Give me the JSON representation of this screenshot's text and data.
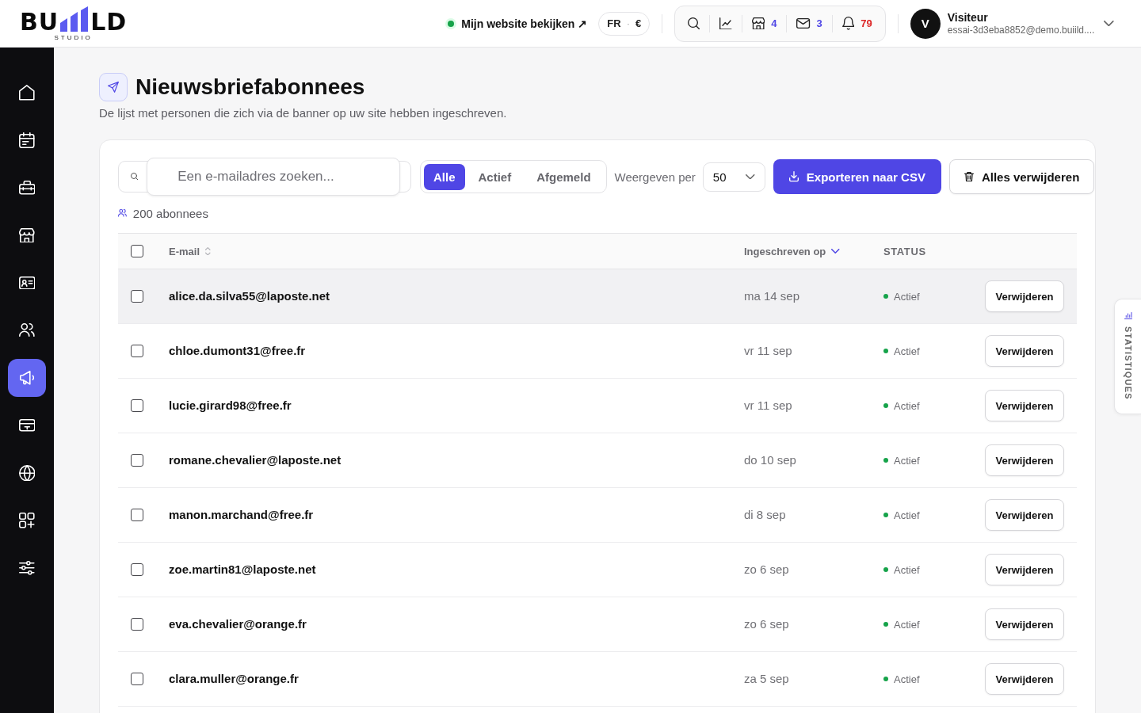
{
  "topbar": {
    "logo": {
      "left": "BU",
      "right": "LD",
      "tagline": "STUDIO"
    },
    "site_link": {
      "label": "Mijn website bekijken ↗",
      "live": true
    },
    "locale": {
      "language": "FR",
      "separator": "·",
      "currency": "€"
    },
    "tools": [
      {
        "kind": "search"
      },
      {
        "kind": "chart"
      },
      {
        "kind": "store",
        "count": "4",
        "color": "#4f46e5"
      },
      {
        "kind": "mail",
        "count": "3",
        "color": "#4f46e5"
      },
      {
        "kind": "bell",
        "count": "79",
        "color": "#dc2626"
      }
    ],
    "user": {
      "initial": "V",
      "name": "Visiteur",
      "email": "essai-3d3eba8852@demo.buiild...."
    }
  },
  "sidebar": {
    "items": [
      {
        "kind": "home",
        "selected": false
      },
      {
        "kind": "calendar",
        "selected": false
      },
      {
        "kind": "toolbox",
        "selected": false
      },
      {
        "kind": "store",
        "selected": false
      },
      {
        "kind": "idcard",
        "selected": false
      },
      {
        "kind": "users",
        "selected": false
      },
      {
        "kind": "megaphone",
        "selected": true
      },
      {
        "kind": "card",
        "selected": false
      },
      {
        "kind": "globe",
        "selected": false
      },
      {
        "kind": "apps",
        "selected": false
      },
      {
        "kind": "sliders",
        "selected": false
      }
    ]
  },
  "page": {
    "title": "Nieuwsbriefabonnees",
    "subtitle": "De lijst met personen die zich via de banner op uw site hebben ingeschreven."
  },
  "toolbar": {
    "search": {
      "placeholder": "Een e-mailadres zoeken..."
    },
    "filters": [
      {
        "label": "Alle",
        "selected": true
      },
      {
        "label": "Actief",
        "selected": false
      },
      {
        "label": "Afgemeld",
        "selected": false
      }
    ],
    "per_page": {
      "label": "Weergeven per",
      "value": "50"
    },
    "buttons": [
      {
        "kind": "export",
        "label": "Exporteren naar CSV"
      },
      {
        "kind": "delete_all",
        "label": "Alles verwijderen"
      }
    ]
  },
  "summary": {
    "count": "200 abonnees"
  },
  "table": {
    "select_all_checked": false,
    "columns": [
      {
        "label": "E-mail",
        "sorted": false
      },
      {
        "label": "Ingeschreven op",
        "sorted": true
      },
      {
        "label": "STATUS"
      }
    ],
    "rows": [
      {
        "email": "alice.da.silva55@laposte.net",
        "date": "ma 14 sep",
        "status": {
          "label": "Actief",
          "color": "#16a34a"
        },
        "action": "Verwijderen",
        "checked": false,
        "highlighted": true
      },
      {
        "email": "chloe.dumont31@free.fr",
        "date": "vr 11 sep",
        "status": {
          "label": "Actief",
          "color": "#16a34a"
        },
        "action": "Verwijderen",
        "checked": false,
        "highlighted": false
      },
      {
        "email": "lucie.girard98@free.fr",
        "date": "vr 11 sep",
        "status": {
          "label": "Actief",
          "color": "#16a34a"
        },
        "action": "Verwijderen",
        "checked": false,
        "highlighted": false
      },
      {
        "email": "romane.chevalier@laposte.net",
        "date": "do 10 sep",
        "status": {
          "label": "Actief",
          "color": "#16a34a"
        },
        "action": "Verwijderen",
        "checked": false,
        "highlighted": false
      },
      {
        "email": "manon.marchand@free.fr",
        "date": "di 8 sep",
        "status": {
          "label": "Actief",
          "color": "#16a34a"
        },
        "action": "Verwijderen",
        "checked": false,
        "highlighted": false
      },
      {
        "email": "zoe.martin81@laposte.net",
        "date": "zo 6 sep",
        "status": {
          "label": "Actief",
          "color": "#16a34a"
        },
        "action": "Verwijderen",
        "checked": false,
        "highlighted": false
      },
      {
        "email": "eva.chevalier@orange.fr",
        "date": "zo 6 sep",
        "status": {
          "label": "Actief",
          "color": "#16a34a"
        },
        "action": "Verwijderen",
        "checked": false,
        "highlighted": false
      },
      {
        "email": "clara.muller@orange.fr",
        "date": "za 5 sep",
        "status": {
          "label": "Actief",
          "color": "#16a34a"
        },
        "action": "Verwijderen",
        "checked": false,
        "highlighted": false
      }
    ]
  },
  "side_tab": {
    "label": "STATISTIQUES"
  }
}
